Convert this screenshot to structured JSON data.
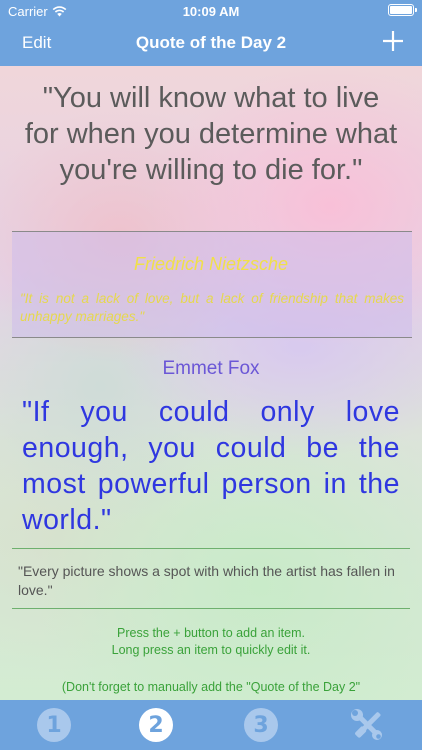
{
  "status_bar": {
    "carrier": "Carrier",
    "time": "10:09 AM",
    "wifi_icon": "wifi-icon",
    "battery_icon": "battery-icon"
  },
  "nav": {
    "edit_label": "Edit",
    "title": "Quote of the Day 2",
    "add_icon": "plus-icon"
  },
  "quotes": [
    {
      "text": "\"You will know what to live for when you determine what you're willing to die for.\"",
      "author": "",
      "color": "#5b5b5b"
    },
    {
      "author": "Friedrich Nietzsche",
      "text": "\"It is not a lack of love, but a lack of friendship that makes unhappy marriages.\"",
      "color": "#e6d84e"
    },
    {
      "author": "Emmet Fox",
      "text": "\"If you could only love enough, you could be the most powerful person in the world.\"",
      "color": "#2f37e0"
    },
    {
      "author": "",
      "text": "\"Every picture shows a spot with which the artist has fallen in love.\"",
      "color": "#555555"
    }
  ],
  "help": {
    "line1": "Press the + button to add an item.",
    "line2": "Long press an item to quickly edit it.",
    "reminder": "(Don't forget to manually add the \"Quote of the Day 2\""
  },
  "tabs": [
    {
      "label": "1",
      "icon": "number-1-icon",
      "active": false
    },
    {
      "label": "2",
      "icon": "number-2-icon",
      "active": true
    },
    {
      "label": "3",
      "icon": "number-3-icon",
      "active": false
    },
    {
      "label": "",
      "icon": "tools-icon",
      "active": false
    }
  ],
  "colors": {
    "bar": "#6ea3dd",
    "help_text": "#3aa23a"
  }
}
